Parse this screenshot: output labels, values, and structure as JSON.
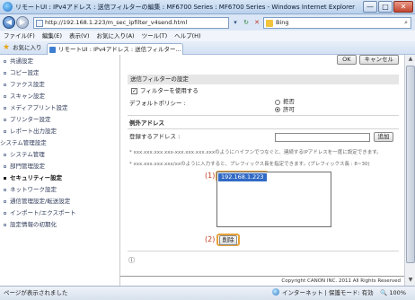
{
  "window": {
    "title": "リモートUI : IPv4アドレス : 送信フィルターの編集 : MF6700 Series : MF6700 Series - Windows Internet Explorer",
    "minimize": "—",
    "maximize": "□",
    "close": "✕"
  },
  "address": {
    "url": "http://192.168.1.223/m_sec_ipfilter_v4send.html",
    "search_engine": "Bing"
  },
  "menu": [
    "ファイル(F)",
    "編集(E)",
    "表示(V)",
    "お気に入り(A)",
    "ツール(T)",
    "ヘルプ(H)"
  ],
  "favorites_label": "お気に入り",
  "tab": {
    "label": "リモートUI : IPv4アドレス : 送信フィルター..."
  },
  "sidebar": {
    "items": [
      {
        "label": "共通設定",
        "type": "sub"
      },
      {
        "label": "コピー設定",
        "type": "sub"
      },
      {
        "label": "ファクス設定",
        "type": "sub"
      },
      {
        "label": "スキャン設定",
        "type": "sub"
      },
      {
        "label": "メディアプリント設定",
        "type": "sub"
      },
      {
        "label": "プリンター設定",
        "type": "sub"
      },
      {
        "label": "レポート出力設定",
        "type": "sub"
      },
      {
        "label": "システム管理設定",
        "type": "group"
      },
      {
        "label": "システム管理",
        "type": "sub"
      },
      {
        "label": "部門管理設定",
        "type": "sub"
      },
      {
        "label": "セキュリティー設定",
        "type": "sub",
        "active": true
      },
      {
        "label": "ネットワーク設定",
        "type": "sub"
      },
      {
        "label": "通信管理設定/転送設定",
        "type": "sub"
      },
      {
        "label": "インポート/エクスポート",
        "type": "sub"
      },
      {
        "label": "設定情報の初期化",
        "type": "sub"
      }
    ]
  },
  "main": {
    "ok_label": "OK",
    "cancel_label": "キャンセル",
    "send_filter_section": "送信フィルターの設定",
    "use_filter_label": "フィルターを使用する",
    "default_policy_label": "デフォルトポリシー :",
    "policy_deny": "拒否",
    "policy_allow": "許可",
    "exception_section": "例外アドレス",
    "register_address_label": "登録するアドレス :",
    "add_label": "追加",
    "note1": "* xxx.xxx.xxx.xxx-xxx.xxx.xxx.xxxのようにハイフンでつなぐと、連続するIPアドレスを一度に設定できます。",
    "note2": "* xxx.xxx.xxx.xxx/xxのように入力すると、プレフィックス長を指定できます。(プレフィックス長 : 8~30)",
    "registered_addresses": [
      "192.168.1.223"
    ],
    "delete_label": "削除",
    "callout1": "(1)",
    "callout2": "(2)",
    "footer_icon_text": "ⓘ",
    "copyright": "Copyright CANON INC. 2011 All Rights Reserved"
  },
  "status": {
    "text": "ページが表示されました",
    "zone": "インターネット | 保護モード: 有効",
    "zoom": "100%"
  }
}
